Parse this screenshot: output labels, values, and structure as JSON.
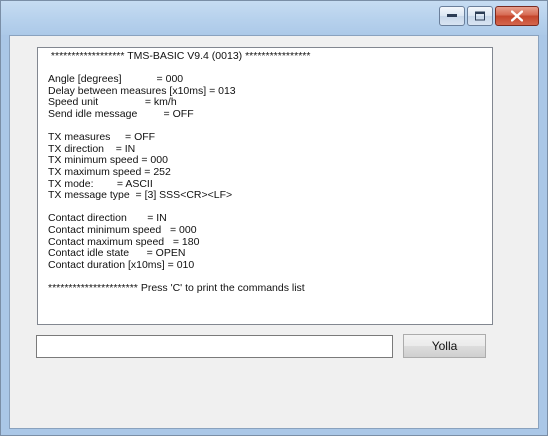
{
  "window": {
    "controls": {
      "minimize": "minimize-icon",
      "maximize": "maximize-icon",
      "close": "close-icon"
    }
  },
  "console": {
    "lines": [
      " ****************** TMS-BASIC V9.4 (0013) ****************",
      "",
      "Angle [degrees]            = 000",
      "Delay between measures [x10ms] = 013",
      "Speed unit                = km/h",
      "Send idle message         = OFF",
      "",
      "TX measures     = OFF",
      "TX direction    = IN",
      "TX minimum speed = 000",
      "TX maximum speed = 252",
      "TX mode:        = ASCII",
      "TX message type  = [3] SSS<CR><LF>",
      "",
      "Contact direction       = IN",
      "Contact minimum speed   = 000",
      "Contact maximum speed   = 180",
      "Contact idle state      = OPEN",
      "Contact duration [x10ms] = 010",
      "",
      "********************** Press 'C' to print the commands list"
    ]
  },
  "command": {
    "value": "",
    "send_label": "Yolla"
  }
}
